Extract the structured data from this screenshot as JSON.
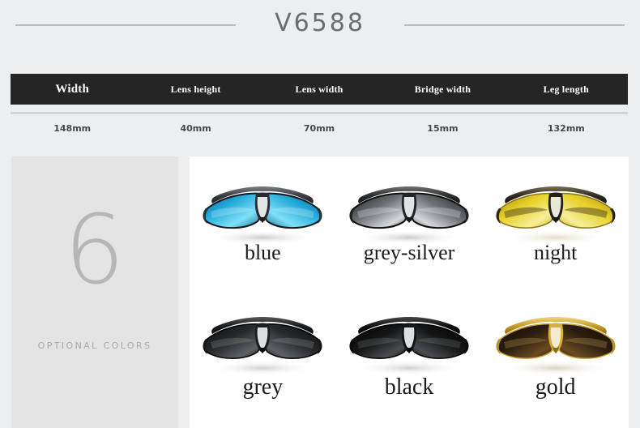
{
  "header": {
    "model": "V6588",
    "rule_icon": "horizontal-rule"
  },
  "spec_table": {
    "columns": [
      "Width",
      "Lens height",
      "Lens width",
      "Bridge width",
      "Leg length"
    ],
    "values": [
      "148mm",
      "40mm",
      "70mm",
      "15mm",
      "132mm"
    ]
  },
  "side_panel": {
    "count": "6",
    "caption": "OPTIONAL COLORS"
  },
  "gallery": {
    "rows": [
      {
        "products": [
          {
            "label": "blue",
            "lens_color": "#1fa7d8",
            "lens_color_dark": "#0b5f86",
            "lens_highlight": "#7fe0f7",
            "frame_color": "#3a3d40",
            "frame_color_light": "#7c8084"
          },
          {
            "label": "grey-silver",
            "lens_color": "#6e7275",
            "lens_color_dark": "#1c1e20",
            "lens_highlight": "#d6d9dc",
            "frame_color": "#2a2c2e",
            "frame_color_light": "#6f7376"
          },
          {
            "label": "night",
            "lens_color": "#e8d028",
            "lens_color_dark": "#a58b0d",
            "lens_highlight": "#f7ef9a",
            "frame_color": "#2e2a22",
            "frame_color_light": "#7a6f50"
          }
        ]
      },
      {
        "products": [
          {
            "label": "grey",
            "lens_color": "#26282a",
            "lens_color_dark": "#0a0b0c",
            "lens_highlight": "#5d6164",
            "frame_color": "#1a1b1d",
            "frame_color_light": "#55595c"
          },
          {
            "label": "black",
            "lens_color": "#141516",
            "lens_color_dark": "#000000",
            "lens_highlight": "#4a4d50",
            "frame_color": "#0f1011",
            "frame_color_light": "#44484b"
          },
          {
            "label": "gold",
            "lens_color": "#2b1d0f",
            "lens_color_dark": "#120c05",
            "lens_highlight": "#6b4a22",
            "frame_color": "#caa02c",
            "frame_color_light": "#f0d681"
          }
        ]
      }
    ]
  }
}
